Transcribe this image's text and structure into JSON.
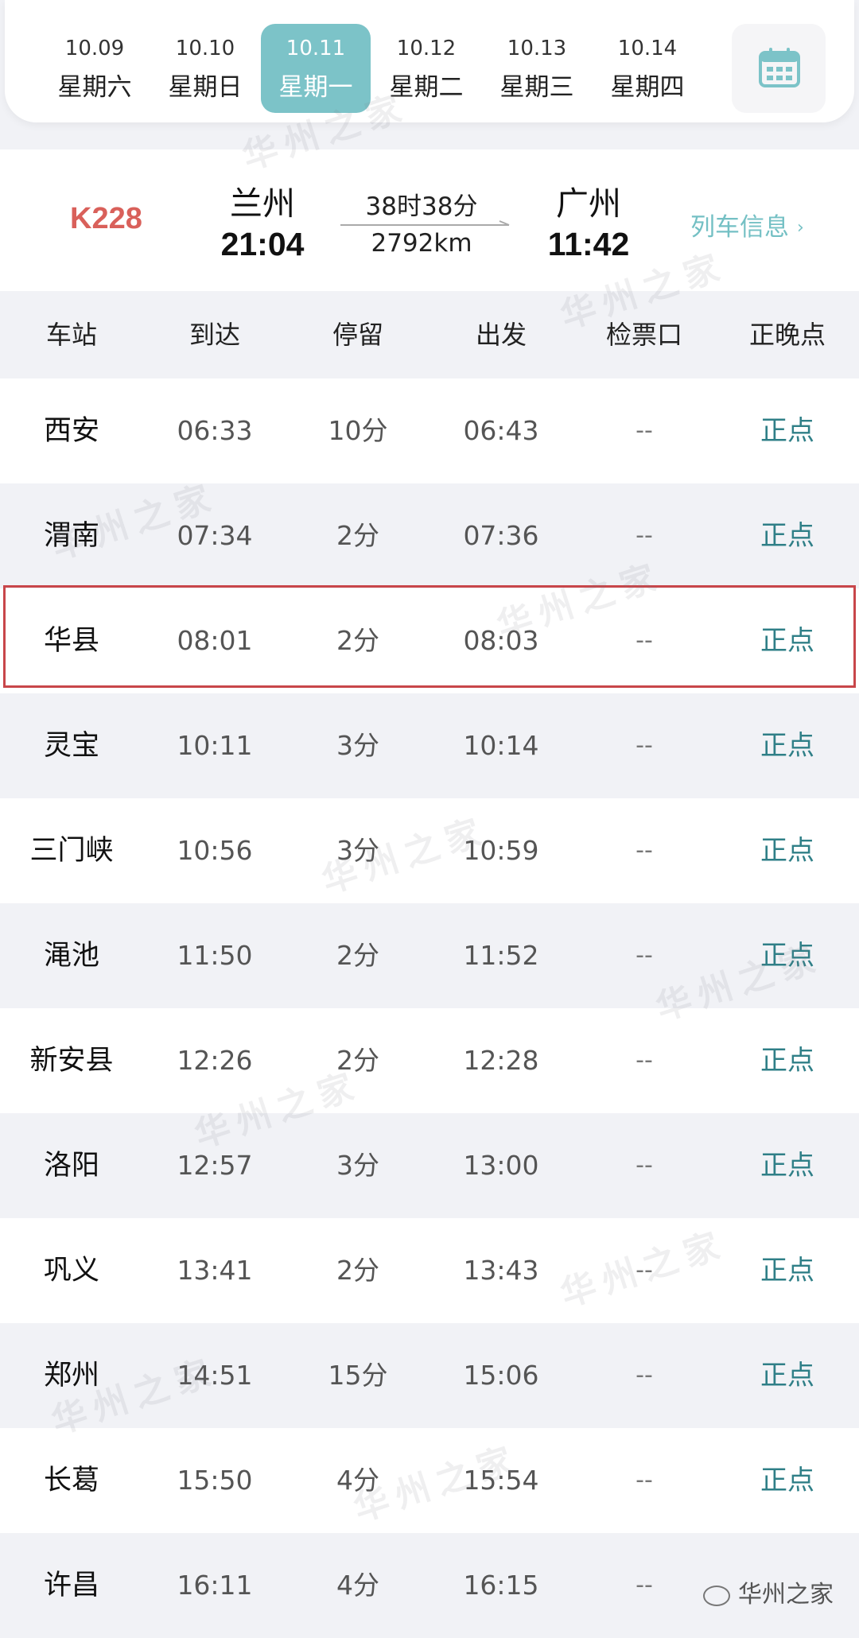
{
  "date_bar": {
    "dates": [
      {
        "date": "10.09",
        "weekday": "星期六"
      },
      {
        "date": "10.10",
        "weekday": "星期日"
      },
      {
        "date": "10.11",
        "weekday": "星期一"
      },
      {
        "date": "10.12",
        "weekday": "星期二"
      },
      {
        "date": "10.13",
        "weekday": "星期三"
      },
      {
        "date": "10.14",
        "weekday": "星期四"
      }
    ],
    "selected": "10.11",
    "calendar_icon": "calendar-icon"
  },
  "train": {
    "number": "K228",
    "from_station": "兰州",
    "from_time": "21:04",
    "duration": "38时38分",
    "distance": "2792km",
    "to_station": "广州",
    "to_time": "11:42",
    "info_link": "列车信息",
    "info_chevron": "›"
  },
  "table": {
    "headers": [
      "车站",
      "到达",
      "停留",
      "出发",
      "检票口",
      "正晚点"
    ],
    "rows": [
      {
        "station": "西安",
        "arrive": "06:33",
        "stop": "10分",
        "depart": "06:43",
        "gate": "--",
        "status": "正点"
      },
      {
        "station": "渭南",
        "arrive": "07:34",
        "stop": "2分",
        "depart": "07:36",
        "gate": "--",
        "status": "正点"
      },
      {
        "station": "华县",
        "arrive": "08:01",
        "stop": "2分",
        "depart": "08:03",
        "gate": "--",
        "status": "正点"
      },
      {
        "station": "灵宝",
        "arrive": "10:11",
        "stop": "3分",
        "depart": "10:14",
        "gate": "--",
        "status": "正点"
      },
      {
        "station": "三门峡",
        "arrive": "10:56",
        "stop": "3分",
        "depart": "10:59",
        "gate": "--",
        "status": "正点"
      },
      {
        "station": "渑池",
        "arrive": "11:50",
        "stop": "2分",
        "depart": "11:52",
        "gate": "--",
        "status": "正点"
      },
      {
        "station": "新安县",
        "arrive": "12:26",
        "stop": "2分",
        "depart": "12:28",
        "gate": "--",
        "status": "正点"
      },
      {
        "station": "洛阳",
        "arrive": "12:57",
        "stop": "3分",
        "depart": "13:00",
        "gate": "--",
        "status": "正点"
      },
      {
        "station": "巩义",
        "arrive": "13:41",
        "stop": "2分",
        "depart": "13:43",
        "gate": "--",
        "status": "正点"
      },
      {
        "station": "郑州",
        "arrive": "14:51",
        "stop": "15分",
        "depart": "15:06",
        "gate": "--",
        "status": "正点"
      },
      {
        "station": "长葛",
        "arrive": "15:50",
        "stop": "4分",
        "depart": "15:54",
        "gate": "--",
        "status": "正点"
      },
      {
        "station": "许昌",
        "arrive": "16:11",
        "stop": "4分",
        "depart": "16:15",
        "gate": "--",
        "status": ""
      }
    ],
    "highlighted_station": "华县"
  },
  "watermark": {
    "text": "华州之家",
    "source": "华州之家"
  },
  "colors": {
    "accent": "#7cc3c8",
    "train_number": "#d9605a",
    "on_time": "#2f7f87",
    "highlight_border": "#c8464a"
  }
}
